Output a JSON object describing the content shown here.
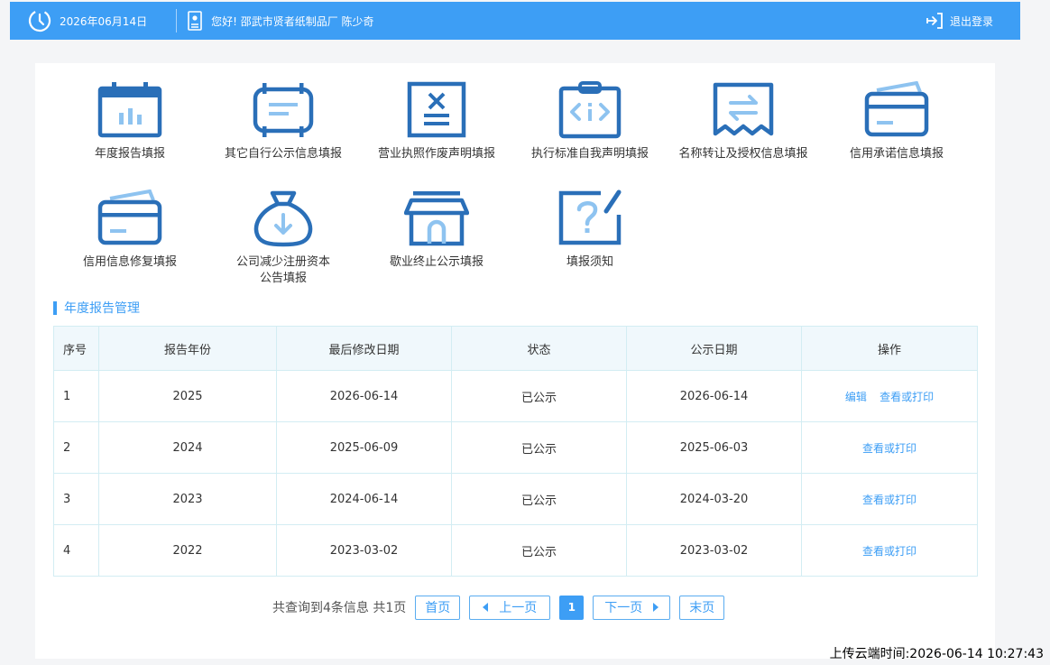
{
  "topbar": {
    "date": "2026年06月14日",
    "greeting": "您好! 邵武市贤者纸制品厂 陈少奇",
    "logout_label": "退出登录"
  },
  "colors": {
    "accent": "#3d9ef5",
    "icon_dark": "#2a6fb8",
    "icon_light": "#8ec3f0"
  },
  "quick_links": [
    {
      "label": "年度报告填报",
      "icon": "calendar-icon"
    },
    {
      "label": "其它自行公示信息填报",
      "icon": "document-board-icon"
    },
    {
      "label": "营业执照作废声明填报",
      "icon": "cancel-doc-icon"
    },
    {
      "label": "执行标准自我声明填报",
      "icon": "clipboard-code-icon"
    },
    {
      "label": "名称转让及授权信息填报",
      "icon": "transfer-icon"
    },
    {
      "label": "信用承诺信息填报",
      "icon": "card-icon"
    },
    {
      "label": "信用信息修复填报",
      "icon": "card-repair-icon"
    },
    {
      "label": "公司减少注册资本",
      "label2": "公告填报",
      "icon": "money-bag-icon"
    },
    {
      "label": "歇业终止公示填报",
      "icon": "store-icon"
    },
    {
      "label": "填报须知",
      "icon": "question-edit-icon"
    }
  ],
  "section_title": "年度报告管理",
  "table": {
    "headers": [
      "序号",
      "报告年份",
      "最后修改日期",
      "状态",
      "公示日期",
      "操作"
    ],
    "rows": [
      {
        "no": "1",
        "year": "2025",
        "modified": "2026-06-14",
        "status": "已公示",
        "published": "2026-06-14",
        "edit": "编辑",
        "view": "查看或打印"
      },
      {
        "no": "2",
        "year": "2024",
        "modified": "2025-06-09",
        "status": "已公示",
        "published": "2025-06-03",
        "view": "查看或打印"
      },
      {
        "no": "3",
        "year": "2023",
        "modified": "2024-06-14",
        "status": "已公示",
        "published": "2024-03-20",
        "view": "查看或打印"
      },
      {
        "no": "4",
        "year": "2022",
        "modified": "2023-03-02",
        "status": "已公示",
        "published": "2023-03-02",
        "view": "查看或打印"
      }
    ]
  },
  "pager": {
    "info": "共查询到4条信息 共1页",
    "first": "首页",
    "prev": "上一页",
    "current": "1",
    "next": "下一页",
    "last": "末页"
  },
  "upload_time": "上传云端时间:2026-06-14 10:27:43"
}
